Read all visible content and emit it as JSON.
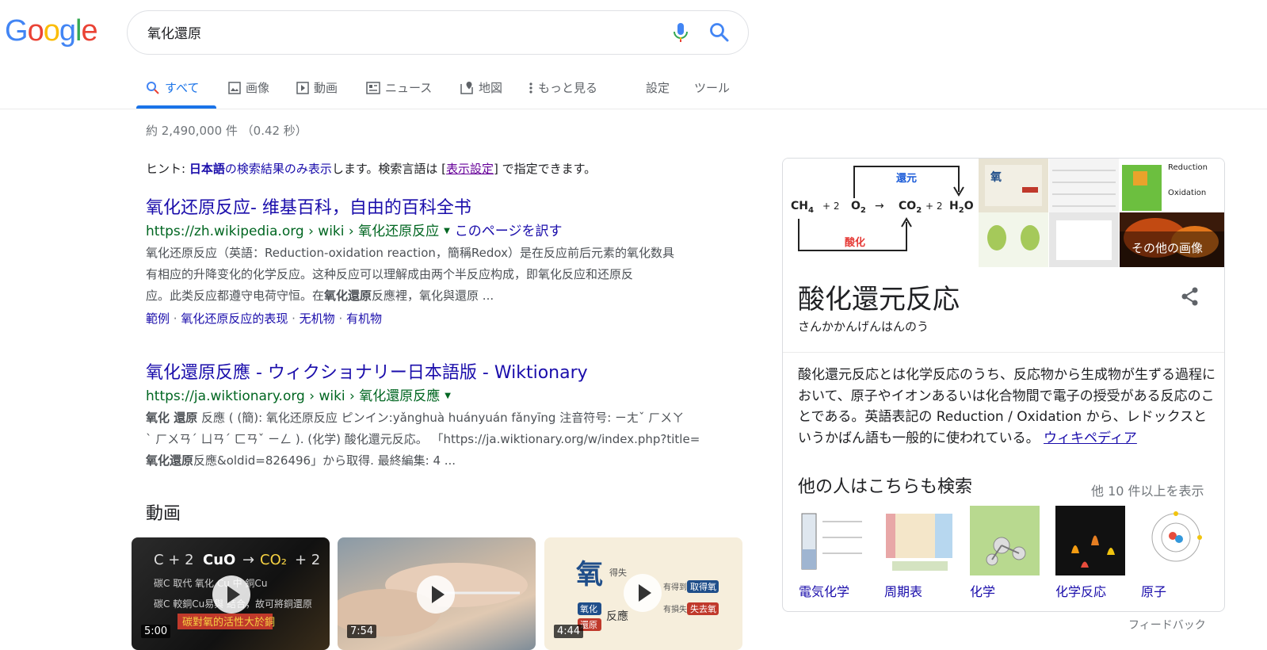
{
  "header": {
    "logo": "Google",
    "query": "氧化還原"
  },
  "tabs": [
    {
      "label": "すべて",
      "icon": "search-icon"
    },
    {
      "label": "画像",
      "icon": "image-icon"
    },
    {
      "label": "動画",
      "icon": "video-icon"
    },
    {
      "label": "ニュース",
      "icon": "news-icon"
    },
    {
      "label": "地図",
      "icon": "map-icon"
    },
    {
      "label": "もっと見る",
      "icon": "more-vert-icon"
    },
    {
      "label": "設定"
    },
    {
      "label": "ツール"
    }
  ],
  "stats": "約 2,490,000 件 （0.42 秒）",
  "hint": {
    "prefix": "ヒント: ",
    "bold": "日本語",
    "link": "の検索結果のみ表示",
    "mid": "します。検索言語は [",
    "settings": "表示設定",
    "suffix": "] で指定できます。"
  },
  "results": [
    {
      "title": "氧化还原反应- 维基百科，自由的百科全书",
      "url": "https://zh.wikipedia.org › wiki › 氧化还原反应",
      "translate": "このページを訳す",
      "snippet_1": "氧化还原反应（英語：Reduction-oxidation reaction，簡稱Redox）是在反应前后元素的氧化数具",
      "snippet_2": "有相应的升降变化的化学反应。这种反应可以理解成由两个半反应构成，即氧化反应和还原反",
      "snippet_3a": "应。此类反应都遵守电荷守恒。在",
      "snippet_3b": "氧化還原",
      "snippet_3c": "反應裡，氧化與還原 ...",
      "sitelinks": [
        "範例",
        "氧化还原反应的表现",
        "无机物",
        "有机物"
      ]
    },
    {
      "title": "氧化還原反應 - ウィクショナリー日本語版 - Wiktionary",
      "url": "https://ja.wiktionary.org › wiki › 氧化還原反應",
      "snippet_1a": "氧化 還原",
      "snippet_1b": " 反應 ( (簡): 氧化还原反应 ピンイン:yǎnghuà huányuán fǎnyīng 注音符号: ㄧㄤˇ ㄏㄨㄚ",
      "snippet_2": "ˋ ㄏㄨㄢˊ ㄩㄢˊ ㄈㄢˇ ㄧㄥ ). (化学) 酸化還元反応。 「https://ja.wiktionary.org/w/index.php?title=",
      "snippet_3a": "氧化還原",
      "snippet_3b": "反應&oldid=826496」から取得. 最終編集: 4 ..."
    }
  ],
  "videos": {
    "heading": "動画",
    "items": [
      {
        "duration": "5:00"
      },
      {
        "duration": "7:54"
      },
      {
        "duration": "4:44"
      }
    ]
  },
  "knowledge_panel": {
    "title": "酸化還元反応",
    "reading": "さんかかんげんはんのう",
    "more_images": "その他の画像",
    "diagram": {
      "top_label": "還元",
      "bottom_label": "酸化",
      "eq_ch4": "CH",
      "eq_plus1": "+ 2",
      "eq_o2": "O",
      "eq_arrow": "→",
      "eq_co2": "CO",
      "eq_plus2": "+ 2",
      "eq_h2o": "H"
    },
    "description": "酸化還元反応とは化学反応のうち、反応物から生成物が生ずる過程において、原子やイオンあるいは化合物間で電子の授受がある反応のことである。英語表記の Reduction / Oxidation から、レドックスというかばん語も一般的に使われている。",
    "source": "ウィキペディア",
    "also_search": "他の人はこちらも検索",
    "more": "他 10 件以上を表示",
    "related": [
      {
        "label": "電気化学"
      },
      {
        "label": "周期表"
      },
      {
        "label": "化学"
      },
      {
        "label": "化学反応"
      },
      {
        "label": "原子"
      }
    ]
  },
  "feedback": "フィードバック",
  "colors": {
    "link": "#1a0dab",
    "url": "#006621",
    "accent": "#1a73e8"
  }
}
